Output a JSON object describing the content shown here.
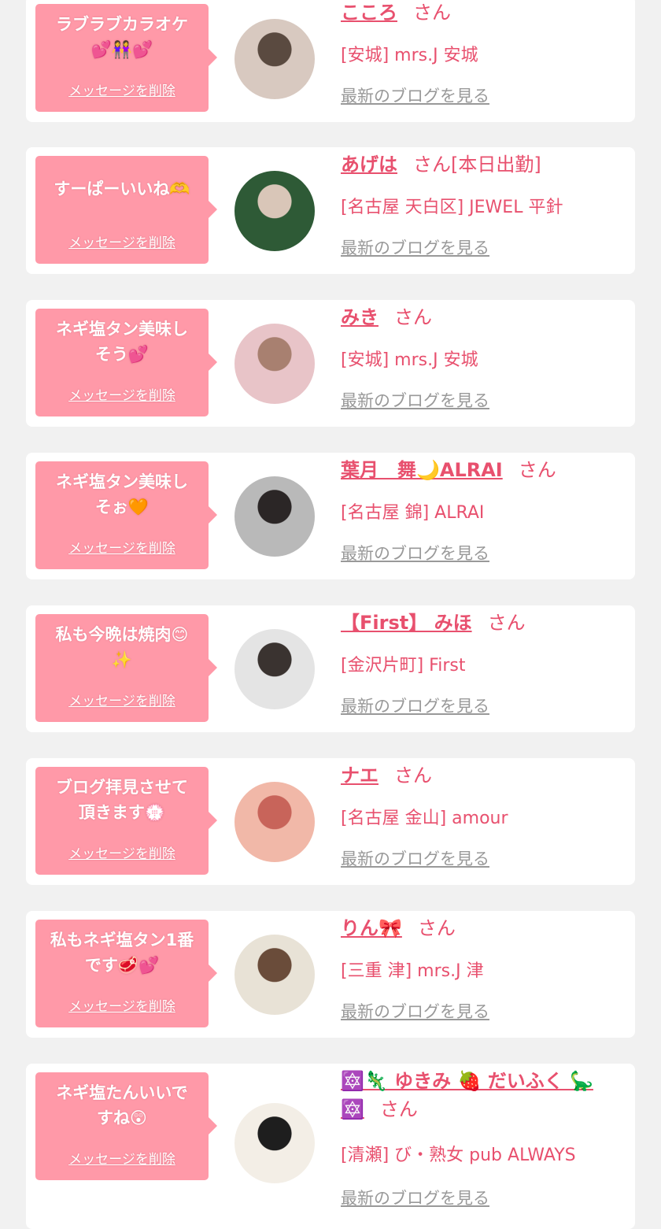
{
  "delete_label": "メッセージを削除",
  "san_label": "さん",
  "blog_label": "最新のブログを見る",
  "colors": {
    "bubble": "#ff99a8",
    "accent": "#e8506e",
    "link_gray": "#999999",
    "background": "#f1f1f1"
  },
  "entries": [
    {
      "message": "ラブラブカラオケ\n💕👭💕",
      "name": "こころ",
      "suffix": "",
      "shop": "[安城] mrs.J 安城",
      "avatar_icon": "avatar-photo-icon",
      "avatar_colors": [
        "#d8c9c0",
        "#5a4a40"
      ]
    },
    {
      "message": "すーぱーいいね🫶",
      "name": "あげは",
      "suffix": "[本日出勤]",
      "shop": "[名古屋 天白区] JEWEL 平針",
      "avatar_icon": "avatar-photo-icon",
      "avatar_colors": [
        "#2e5a36",
        "#d9c6b8"
      ]
    },
    {
      "message": "ネギ塩タン美味し\nそう💕",
      "name": "みき",
      "suffix": "",
      "shop": "[安城] mrs.J 安城",
      "avatar_icon": "avatar-photo-icon",
      "avatar_colors": [
        "#e8c4c8",
        "#a88070"
      ]
    },
    {
      "message": "ネギ塩タン美味し\nそぉ🧡",
      "name": "葉月　舞🌙ALRAI",
      "suffix": "",
      "shop": "[名古屋 錦] ALRAI",
      "avatar_icon": "avatar-photo-icon",
      "avatar_colors": [
        "#b9b9b9",
        "#2b2626"
      ]
    },
    {
      "message": "私も今晩は焼肉😊\n✨",
      "name": "【First】 みほ",
      "suffix": "",
      "shop": "[金沢片町] First",
      "avatar_icon": "avatar-photo-icon",
      "avatar_colors": [
        "#e4e4e4",
        "#3a3330"
      ]
    },
    {
      "message": "ブログ拝見させて\n頂きます💮",
      "name": "ナエ",
      "suffix": "",
      "shop": "[名古屋 金山] amour",
      "avatar_icon": "avatar-photo-icon",
      "avatar_colors": [
        "#f1b8a8",
        "#c8645a"
      ]
    },
    {
      "message": "私もネギ塩タン1番\nです🥩💕",
      "name": "りん🎀",
      "suffix": "",
      "shop": "[三重 津] mrs.J 津",
      "avatar_icon": "avatar-photo-icon",
      "avatar_colors": [
        "#e8e2d6",
        "#6a4c3a"
      ]
    },
    {
      "message": "ネギ塩たんいいで\nすね😲",
      "name": "🔯🦎 ゆきみ 🍓 だいふく 🦕\n🔯",
      "suffix": "",
      "shop": "[清瀬] び・熟女 pub ALWAYS",
      "avatar_icon": "avatar-illustration-icon",
      "avatar_colors": [
        "#f3eee6",
        "#1e1e1e"
      ]
    }
  ]
}
